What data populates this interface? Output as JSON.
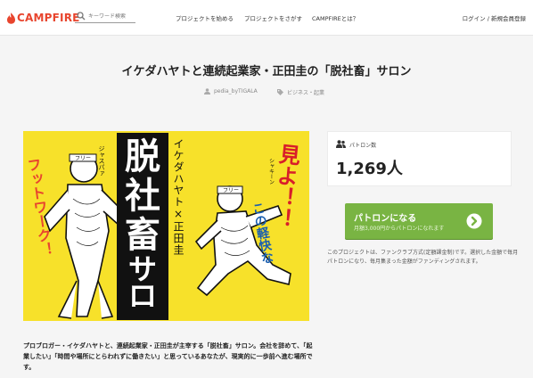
{
  "header": {
    "logo_text": "CAMPFIRE",
    "search_placeholder": "キーワード検索",
    "nav": [
      "プロジェクトを始める",
      "プロジェクトをさがす",
      "CAMPFIREとは？"
    ],
    "auth": "ログイン / 新規会員登録"
  },
  "project": {
    "title": "イケダハヤトと連続起業家・正田圭の「脱社畜」サロン",
    "owner": "pedia_byTIGALA",
    "category": "ビジネス・起業",
    "description": "プロブロガー・イケダハヤトと、連続起業家・正田圭が主宰する「脱社畜」サロン。会社を辞めて、「起業したい」「時間や場所にとらわれずに働きたい」と思っているあなたが、現実的に一歩前へ進む場所です。"
  },
  "hero": {
    "center_title": "脱社畜サロン",
    "names": "イケダハヤト×正田圭",
    "left_slogan": "フットワーク！",
    "right_slogan": "見よ！！",
    "right_sub": "この軽快な",
    "tags": [
      "フリー",
      "フリー"
    ],
    "scribble_left": "ジャスパァ",
    "scribble_right": "シャキーン"
  },
  "sidebar": {
    "patron_label": "パトロン数",
    "patron_count": "1,269人",
    "join_title": "パトロンになる",
    "join_sub": "月額3,000円からパトロンになれます",
    "note": "このプロジェクトは、ファンクラブ方式(定額課金制)です。選択した金額で毎月パトロンになり、毎月集まった金額がファンディングされます。"
  },
  "colors": {
    "brand": "#e8452e",
    "button": "#79b443",
    "hero_bg": "#f7e12a"
  }
}
